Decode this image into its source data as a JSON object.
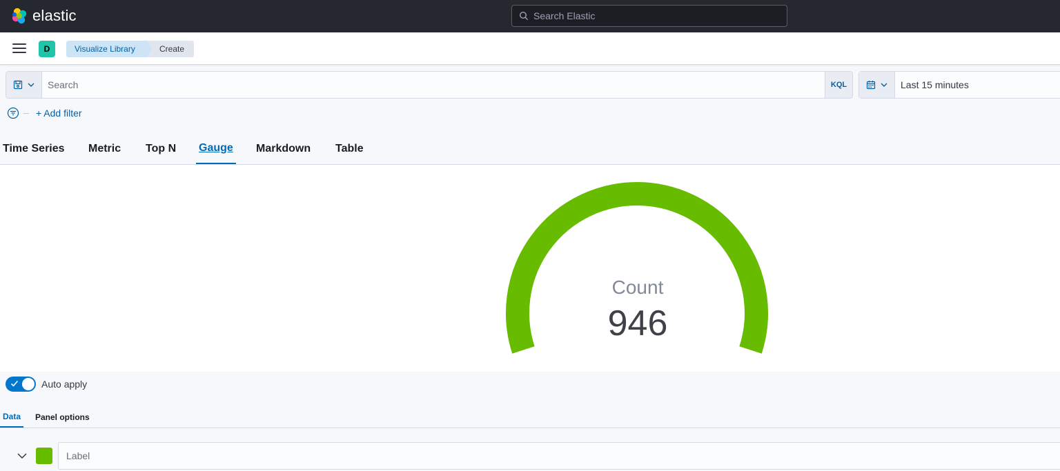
{
  "header": {
    "logo_text": "elastic",
    "search_placeholder": "Search Elastic"
  },
  "breadcrumbs": {
    "space_initial": "D",
    "items": [
      "Visualize Library",
      "Create"
    ]
  },
  "query": {
    "placeholder": "Search",
    "language": "KQL",
    "time_range": "Last 15 minutes",
    "add_filter": "+ Add filter"
  },
  "vis_tabs": {
    "items": [
      "Time Series",
      "Metric",
      "Top N",
      "Gauge",
      "Markdown",
      "Table"
    ],
    "active": "Gauge"
  },
  "gauge": {
    "label": "Count",
    "value": "946",
    "fill_fraction": 1.0,
    "color": "#68bc00"
  },
  "editor": {
    "auto_apply_label": "Auto apply",
    "auto_apply_on": true,
    "tabs": [
      "Data",
      "Panel options"
    ],
    "active_tab": "Data",
    "series_label_placeholder": "Label",
    "series_color": "#68bc00"
  }
}
